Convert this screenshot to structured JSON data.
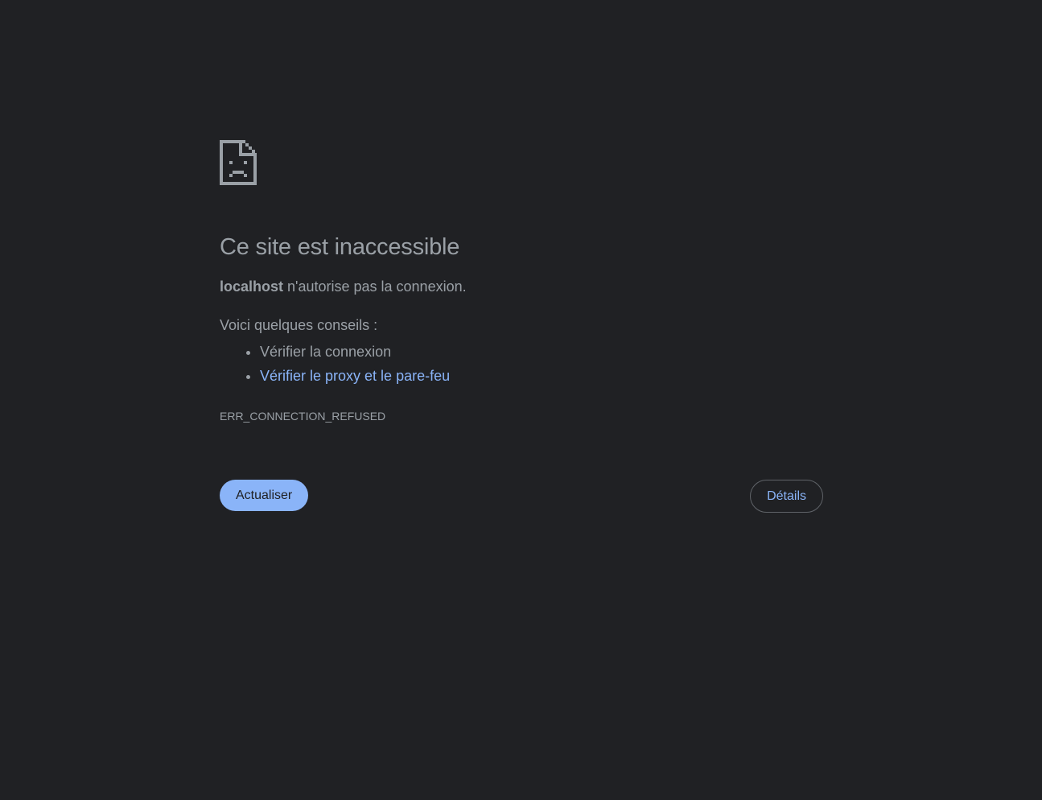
{
  "icon": "sad-document-icon",
  "colors": {
    "background": "#202124",
    "text": "#9aa0a6",
    "link": "#8ab4f8",
    "button_primary_bg": "#8ab4f8",
    "button_border": "#5f6368"
  },
  "error": {
    "title": "Ce site est inaccessible",
    "host": "localhost",
    "summary_rest": " n'autorise pas la connexion.",
    "suggestions_heading": "Voici quelques conseils :",
    "suggestions": [
      {
        "label": "Vérifier la connexion",
        "is_link": false
      },
      {
        "label": "Vérifier le proxy et le pare-feu",
        "is_link": true
      }
    ],
    "code": "ERR_CONNECTION_REFUSED"
  },
  "buttons": {
    "reload_label": "Actualiser",
    "details_label": "Détails"
  }
}
